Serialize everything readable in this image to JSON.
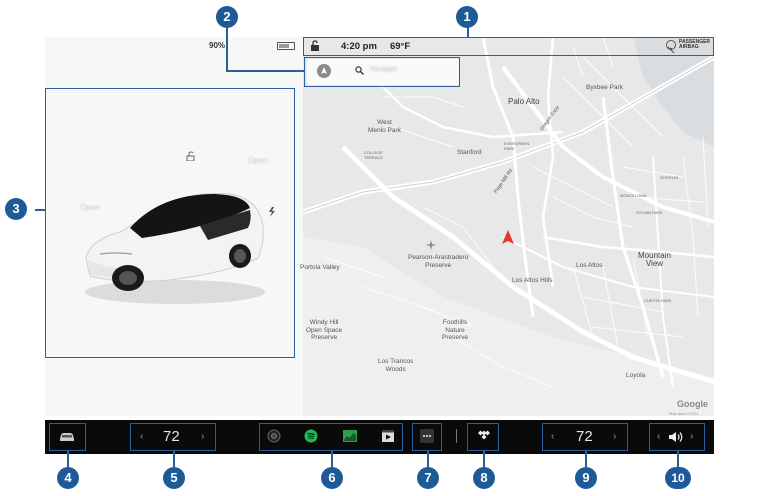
{
  "status_bar": {
    "battery": "90%",
    "time": "4:20 pm",
    "temperature": "69°F",
    "airbag_line1": "PASSENGER",
    "airbag_line2": "AIRBAG"
  },
  "search": {
    "placeholder": "Navigate"
  },
  "car_panel": {
    "left_label": "Open",
    "right_label": "Open"
  },
  "map": {
    "labels": {
      "palo_alto": "Palo Alto",
      "byxbee_park": "Byxbee Park",
      "west_menlo_park": "West\nMenlo Park",
      "stanford": "Stanford",
      "evergreen_park": "EVERGREEN\nPARK",
      "college_terrace": "COLLEGE\nTERRACE",
      "oregon_expy": "Oregon Expy",
      "page_mill_rd": "Page Mill Rd",
      "pearson": "Pearson-Arastradero\nPreserve",
      "portola_valley": "Portola Valley",
      "los_altos_hills": "Los Altos Hills",
      "los_altos": "Los Altos",
      "mountain_view": "Mountain\nView",
      "cuesta_park": "CUESTA PARK",
      "windy_hill": "Windy Hill\nOpen Space\nPreserve",
      "foothills": "Foothills\nNature\nPreserve",
      "los_trancos": "Los Trancos\nWoods",
      "loyola": "Loyola",
      "sylvan_park": "SYLVAN PARK",
      "monta_loma": "MONTA LOMA",
      "stierlin": "STIERLIN"
    },
    "attribution_google": "Google",
    "attribution_data": "Map data ©2021"
  },
  "dock": {
    "driver_temp": "72",
    "passenger_temp": "72",
    "left_chevron": "‹",
    "right_chevron": "›"
  },
  "callouts": [
    "1",
    "2",
    "3",
    "4",
    "5",
    "6",
    "7",
    "8",
    "9",
    "10"
  ],
  "icons": {
    "car": "car-icon",
    "camera": "camera-icon",
    "spotify": "spotify-icon",
    "energy": "energy-icon",
    "theater": "theater-icon",
    "more": "more-icon",
    "tidal": "tidal-icon",
    "volume": "volume-icon",
    "lock": "lock-icon",
    "search": "search-icon",
    "nav": "navigation-icon"
  },
  "colors": {
    "callout_blue": "#1f5a98",
    "dock_background": "#0a0a0a",
    "nav_arrow": "#e8362b",
    "spotify_green": "#1db954",
    "energy_green": "#2e9e4a"
  }
}
